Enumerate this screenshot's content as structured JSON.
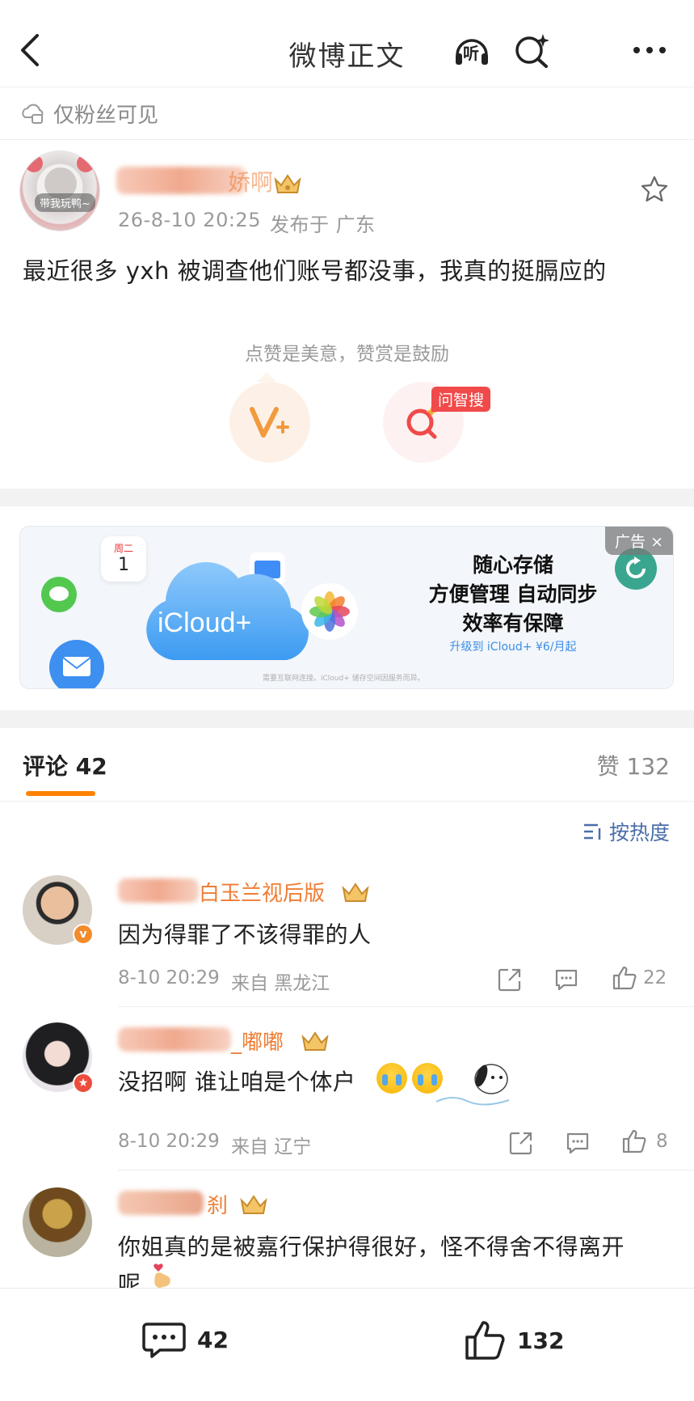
{
  "header": {
    "title": "微博正文",
    "listen_label": "听"
  },
  "visibility": {
    "label": "仅粉丝可见"
  },
  "post": {
    "author": {
      "name_visible": "娇啊",
      "avatar_sticker": "带我玩鸭~"
    },
    "time": "26-8-10 20:25",
    "location": "发布于 广东",
    "text": "最近很多 yxh 被调查他们账号都没事，我真的挺膈应的",
    "praise_hint": "点赞是美意，赞赏是鼓励",
    "ask_badge": "问智搜"
  },
  "ad": {
    "tag": "广告",
    "close": "×",
    "calendar_day": "周二",
    "calendar_num": "1",
    "brand": "iCloud+",
    "line1": "随心存储",
    "line2": "方便管理 自动同步",
    "line3": "效率有保障",
    "cta": "升级到 iCloud+ ¥6/月起",
    "fineprint": "需要互联网连接。iCloud+ 储存空间因服务而异。"
  },
  "comments_header": {
    "tab_label": "评论 42",
    "likes_label": "赞 132",
    "sort_label": "按热度"
  },
  "comments": [
    {
      "name_visible": "白玉兰视后版",
      "text": "因为得罪了不该得罪的人",
      "time": "8-10 20:29",
      "location": "来自 黑龙江",
      "likes": "22"
    },
    {
      "name_visible": "_嘟嘟",
      "text": "没招啊 谁让咱是个体户",
      "time": "8-10 20:29",
      "location": "来自 辽宁",
      "likes": "8"
    },
    {
      "name_visible": "刹",
      "text_line1": "你姐真的是被嘉行保护得很好，怪不得舍不得离开",
      "text_line2": "呢"
    }
  ],
  "bottom_bar": {
    "comments": "42",
    "likes": "132"
  },
  "colors": {
    "accent": "#ff8200",
    "name": "#ef7d35",
    "link": "#4a6ea9"
  }
}
